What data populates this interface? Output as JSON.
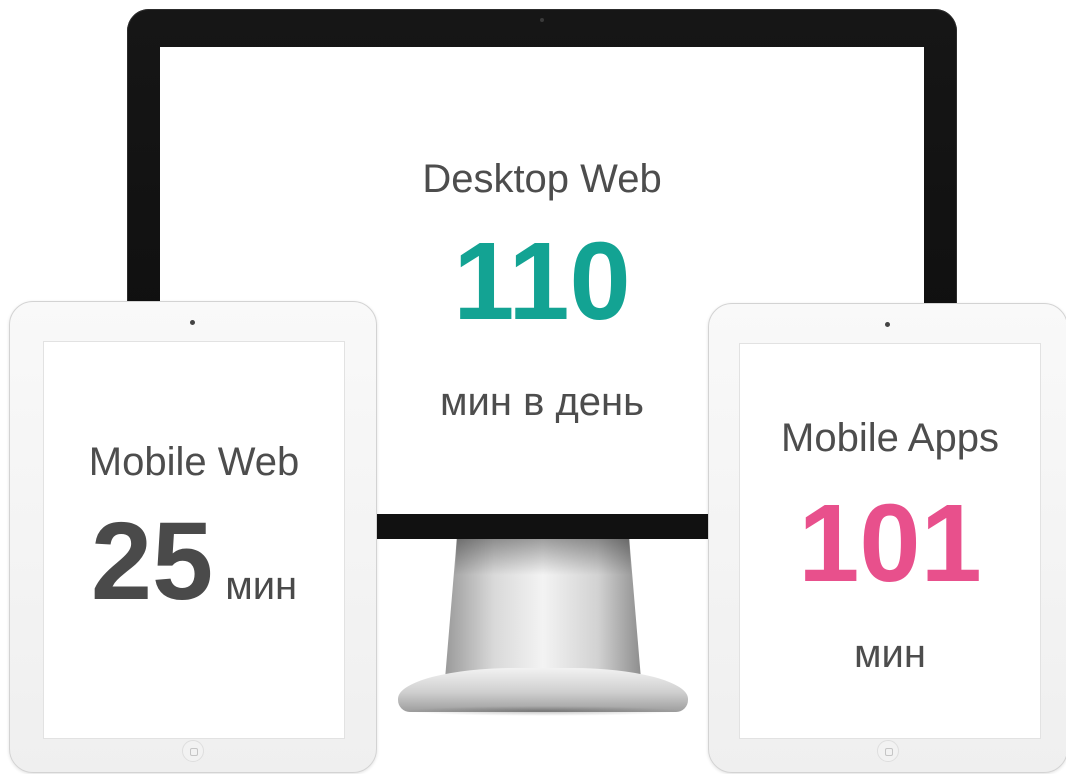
{
  "colors": {
    "desktop_accent": "#13a393",
    "mobile_web_accent": "#4a4a4a",
    "mobile_apps_accent": "#e8508c",
    "text": "#4d4d4d"
  },
  "desktop": {
    "title": "Desktop Web",
    "value": "110",
    "unit": "мин в день"
  },
  "mobile_web": {
    "title": "Mobile Web",
    "value": "25",
    "unit": "мин"
  },
  "mobile_apps": {
    "title": "Mobile Apps",
    "value": "101",
    "unit": "мин"
  }
}
